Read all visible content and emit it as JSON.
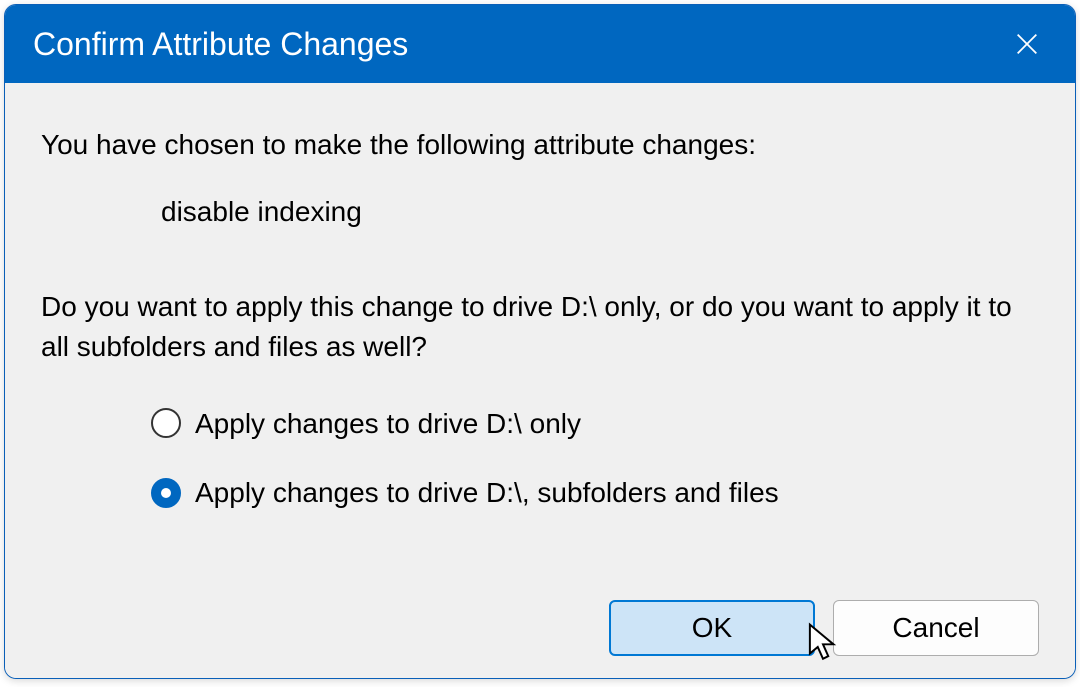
{
  "titlebar": {
    "title": "Confirm Attribute Changes"
  },
  "content": {
    "intro": "You have chosen to make the following attribute changes:",
    "change": "disable indexing",
    "question": "Do you want to apply this change to drive D:\\ only, or do you want to apply it to all subfolders and files as well?"
  },
  "options": {
    "drive_only": "Apply changes to drive D:\\ only",
    "subfolders": "Apply changes to drive D:\\, subfolders and files"
  },
  "buttons": {
    "ok": "OK",
    "cancel": "Cancel"
  }
}
